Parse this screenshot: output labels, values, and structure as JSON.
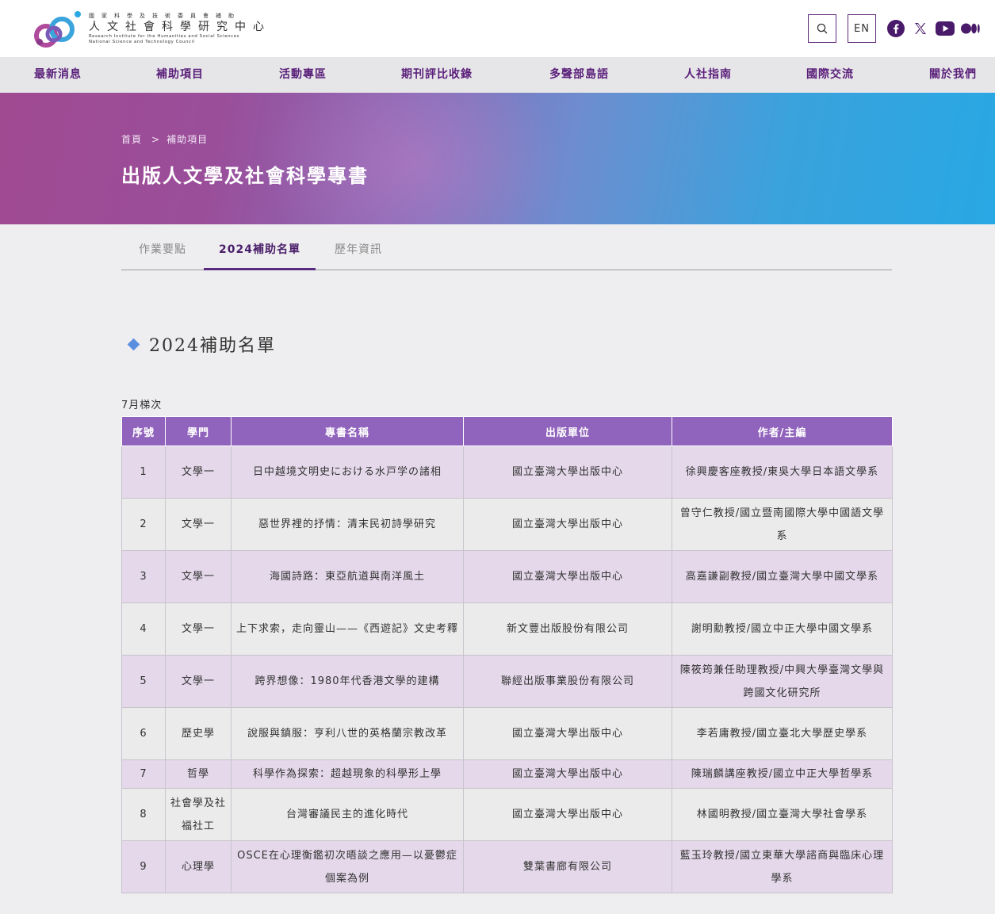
{
  "header": {
    "logo_sup": "國家科學及技術委員會補助",
    "logo_main": "人文社會科學研究中心",
    "logo_en_line1": "Research Institute for the Humanities and Social Sciences",
    "logo_en_line2": "National Science and Technology Council",
    "lang_label": "EN",
    "icons": [
      "search-icon",
      "facebook-icon",
      "x-icon",
      "youtube-icon",
      "medium-icon"
    ]
  },
  "nav": {
    "items": [
      {
        "label": "最新消息"
      },
      {
        "label": "補助項目"
      },
      {
        "label": "活動專區"
      },
      {
        "label": "期刊評比收錄"
      },
      {
        "label": "多聲部島語"
      },
      {
        "label": "人社指南"
      },
      {
        "label": "國際交流"
      },
      {
        "label": "關於我們"
      }
    ]
  },
  "banner": {
    "breadcrumb_home": "首頁",
    "breadcrumb_sep": ">",
    "breadcrumb_current": "補助項目",
    "title": "出版人文學及社會科學專書"
  },
  "tabs": [
    {
      "label": "作業要點"
    },
    {
      "label": "2024補助名單"
    },
    {
      "label": "歷年資訊"
    }
  ],
  "section": {
    "title": "2024補助名單",
    "batch": "7月梯次"
  },
  "table": {
    "headers": [
      "序號",
      "學門",
      "專書名稱",
      "出版單位",
      "作者/主編"
    ],
    "rows": [
      {
        "no": "1",
        "field": "文學一",
        "title": "日中越境文明史における水戸学の諸相",
        "publisher": "國立臺灣大學出版中心",
        "author": "徐興慶客座教授/東吳大學日本語文學系"
      },
      {
        "no": "2",
        "field": "文學一",
        "title": "惡世界裡的抒情：清末民初詩學研究",
        "publisher": "國立臺灣大學出版中心",
        "author": "曾守仁教授/國立暨南國際大學中國語文學系"
      },
      {
        "no": "3",
        "field": "文學一",
        "title": "海國詩路：東亞航道與南洋風土",
        "publisher": "國立臺灣大學出版中心",
        "author": "高嘉謙副教授/國立臺灣大學中國文學系"
      },
      {
        "no": "4",
        "field": "文學一",
        "title": "上下求索，走向靈山——《西遊記》文史考釋",
        "publisher": "新文豐出版股份有限公司",
        "author": "謝明勳教授/國立中正大學中國文學系"
      },
      {
        "no": "5",
        "field": "文學一",
        "title": "跨界想像：1980年代香港文學的建構",
        "publisher": "聯經出版事業股份有限公司",
        "author": "陳筱筠兼任助理教授/中興大學臺灣文學與跨國文化研究所"
      },
      {
        "no": "6",
        "field": "歷史學",
        "title": "說服與鎮服：亨利八世的英格蘭宗教改革",
        "publisher": "國立臺灣大學出版中心",
        "author": "李若庸教授/國立臺北大學歷史學系"
      },
      {
        "no": "7",
        "field": "哲學",
        "title": "科學作為探索：超越現象的科學形上學",
        "publisher": "國立臺灣大學出版中心",
        "author": "陳瑞麟講座教授/國立中正大學哲學系"
      },
      {
        "no": "8",
        "field": "社會學及社福社工",
        "title": "台灣審議民主的進化時代",
        "publisher": "國立臺灣大學出版中心",
        "author": "林國明教授/國立臺灣大學社會學系"
      },
      {
        "no": "9",
        "field": "心理學",
        "title": "OSCE在心理衡鑑初次晤談之應用—以憂鬱症個案為例",
        "publisher": "雙葉書廊有限公司",
        "author": "藍玉玲教授/國立東華大學諮商與臨床心理學系"
      }
    ]
  },
  "colors": {
    "brand_purple": "#5a1f7a",
    "table_header": "#9063bc",
    "row_odd": "#e4d8ea",
    "row_even": "#ebebeb",
    "accent_blue": "#5a8fe0"
  }
}
